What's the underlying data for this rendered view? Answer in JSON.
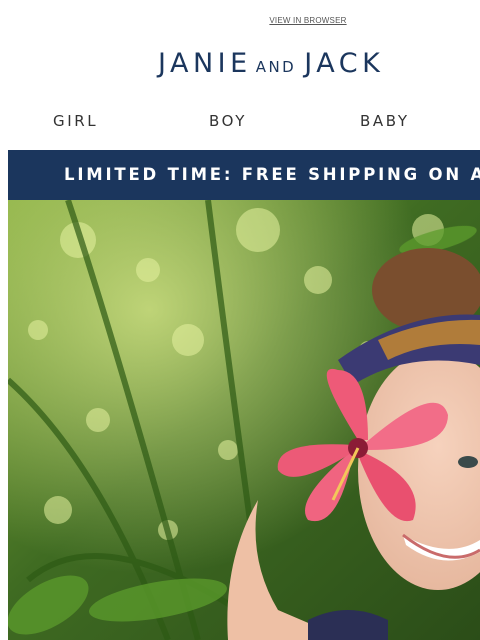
{
  "header": {
    "view_in_browser": "VIEW IN BROWSER",
    "logo": {
      "part1": "JANIE",
      "part2": "AND",
      "part3": "JACK"
    }
  },
  "nav": {
    "items": [
      {
        "label": "GIRL"
      },
      {
        "label": "BOY"
      },
      {
        "label": "BABY"
      }
    ]
  },
  "promo": {
    "text": "LIMITED TIME: FREE SHIPPING ON ANY ORDER"
  },
  "colors": {
    "brand_navy": "#1b365d",
    "background": "#ffffff"
  }
}
